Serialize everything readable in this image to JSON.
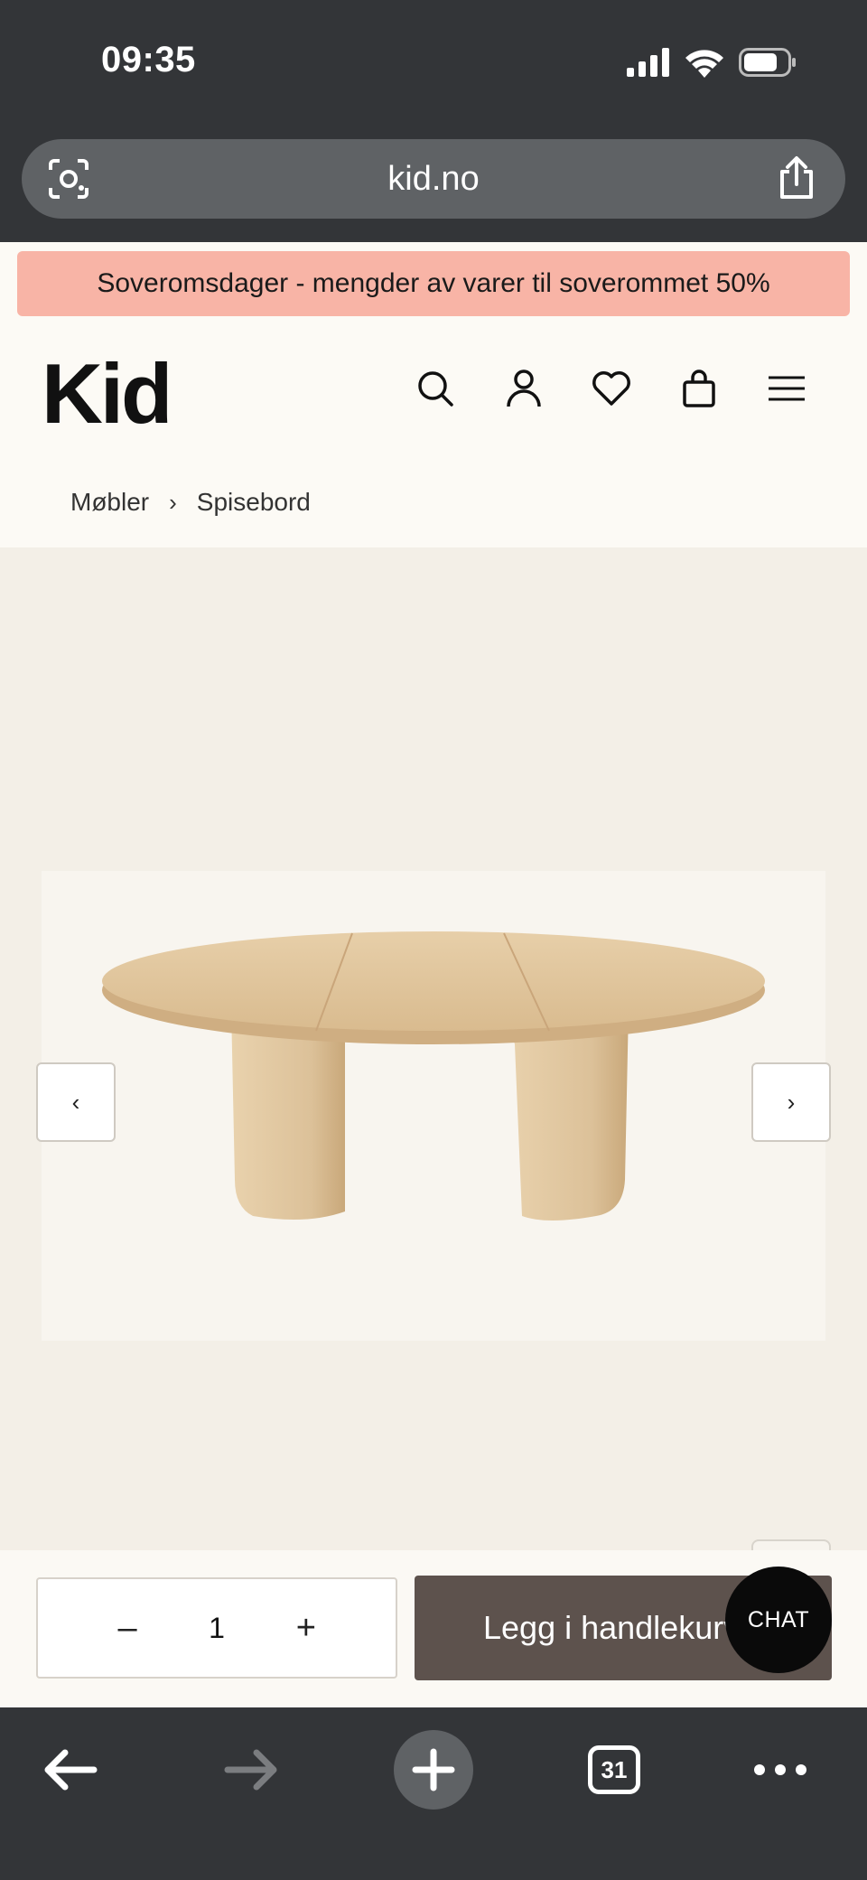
{
  "status_bar": {
    "time": "09:35"
  },
  "browser": {
    "url": "kid.no",
    "tab_count": "31"
  },
  "promo": {
    "text": "Soveromsdager - mengder av varer til soverommet 50%"
  },
  "header": {
    "logo": "Kid"
  },
  "breadcrumb": {
    "items": [
      "Møbler",
      "Spisebord"
    ],
    "separator": "›"
  },
  "gallery": {
    "prev_label": "‹",
    "next_label": "›"
  },
  "cart": {
    "quantity": "1",
    "minus_label": "–",
    "plus_label": "+",
    "add_label": "Legg i handlekurv"
  },
  "chat": {
    "label": "CHAT"
  }
}
